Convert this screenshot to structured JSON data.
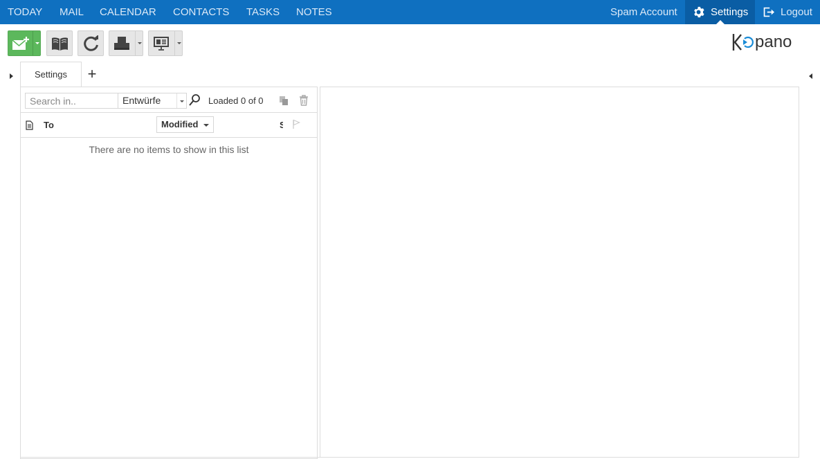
{
  "nav": {
    "items": [
      "TODAY",
      "MAIL",
      "CALENDAR",
      "CONTACTS",
      "TASKS",
      "NOTES"
    ],
    "spam_account": "Spam Account",
    "settings": "Settings",
    "logout": "Logout"
  },
  "colors": {
    "topbar": "#0f70c0",
    "active_nav": "#0a5da4",
    "new_button": "#5cb85c"
  },
  "toolbar": {
    "icons": [
      "new-mail-icon",
      "address-book-icon",
      "refresh-icon",
      "print-icon",
      "view-layout-icon"
    ]
  },
  "tabs": [
    {
      "label": "Settings"
    }
  ],
  "tab_add": "+",
  "list": {
    "search_placeholder": "Search in..",
    "folder": "Entwürfe",
    "loaded": "Loaded 0 of 0",
    "columns": {
      "to": "To",
      "modified": "Modified",
      "s": "S"
    },
    "empty_message": "There are no items to show in this list"
  }
}
